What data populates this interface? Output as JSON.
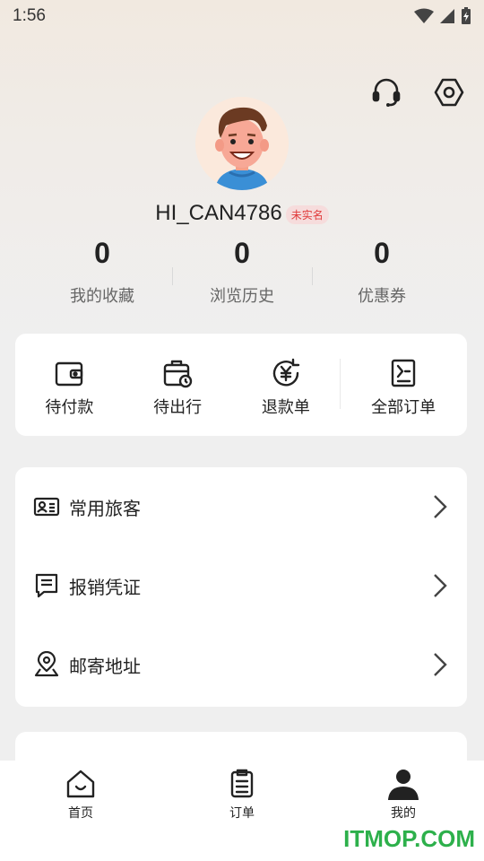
{
  "status_bar": {
    "time": "1:56"
  },
  "profile": {
    "username": "HI_CAN4786",
    "badge": "未实名"
  },
  "stats": [
    {
      "value": "0",
      "label": "我的收藏"
    },
    {
      "value": "0",
      "label": "浏览历史"
    },
    {
      "value": "0",
      "label": "优惠券"
    }
  ],
  "orders": [
    {
      "label": "待付款",
      "icon": "wallet-icon"
    },
    {
      "label": "待出行",
      "icon": "suitcase-clock-icon"
    },
    {
      "label": "退款单",
      "icon": "yuan-refund-icon"
    },
    {
      "label": "全部订单",
      "icon": "order-list-icon"
    }
  ],
  "menu": [
    {
      "label": "常用旅客",
      "icon": "id-card-icon"
    },
    {
      "label": "报销凭证",
      "icon": "receipt-icon"
    },
    {
      "label": "邮寄地址",
      "icon": "location-pin-icon"
    }
  ],
  "tabs": [
    {
      "label": "首页",
      "icon": "home-icon"
    },
    {
      "label": "订单",
      "icon": "order-icon"
    },
    {
      "label": "我的",
      "icon": "profile-icon"
    }
  ],
  "watermark": "ITMOP.COM"
}
